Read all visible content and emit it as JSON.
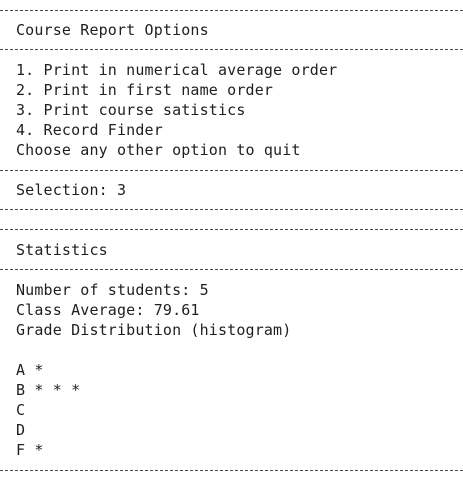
{
  "header": {
    "title": "Course Report Options"
  },
  "menu": {
    "items": [
      "1. Print in numerical average order",
      "2. Print in first name order",
      "3. Print course satistics",
      "4. Record Finder"
    ],
    "quit_prompt": "Choose any other option to quit"
  },
  "selection": {
    "text": "Selection: 3"
  },
  "statistics": {
    "title": "Statistics",
    "student_count": "Number of students: 5",
    "class_average": "Class Average: 79.61",
    "distribution_label": "Grade Distribution (histogram)",
    "histogram": [
      {
        "grade": "A",
        "bar": "*"
      },
      {
        "grade": "B",
        "bar": "* * *"
      },
      {
        "grade": "C",
        "bar": ""
      },
      {
        "grade": "D",
        "bar": ""
      },
      {
        "grade": "F",
        "bar": "*"
      }
    ]
  }
}
